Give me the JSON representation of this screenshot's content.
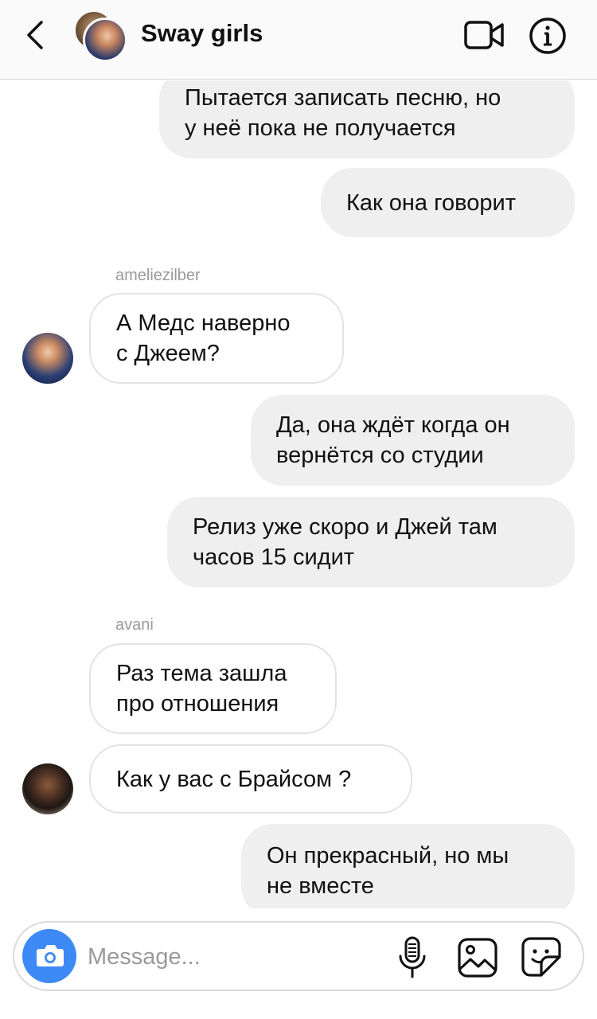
{
  "header": {
    "title": "Sway girls",
    "icons": {
      "back": "chevron-left-icon",
      "video": "video-camera-icon",
      "info": "info-icon"
    }
  },
  "messages": [
    {
      "direction": "outgoing",
      "text": "Пытается записать песню, но\nу неё пока не получается"
    },
    {
      "direction": "outgoing",
      "text": "Как она говорит"
    },
    {
      "direction": "incoming",
      "sender": "ameliezilber",
      "text": "А Медс наверно\nс Джеем?"
    },
    {
      "direction": "outgoing",
      "text": "Да, она ждёт когда он\nвернётся со студии"
    },
    {
      "direction": "outgoing",
      "text": "Релиз уже скоро и Джей там\nчасов 15 сидит"
    },
    {
      "direction": "incoming",
      "sender": "avani",
      "text": "Раз тема зашла\nпро отношения"
    },
    {
      "direction": "incoming",
      "text": "Как у вас с Брайсом ?"
    },
    {
      "direction": "outgoing",
      "text": "Он прекрасный, но мы\nне вместе"
    }
  ],
  "composer": {
    "placeholder": "Message...",
    "icons": {
      "camera": "camera-icon",
      "mic": "microphone-icon",
      "gallery": "image-icon",
      "sticker": "sticker-icon"
    }
  },
  "colors": {
    "outgoing_bubble": "#efefef",
    "incoming_border": "#e3e3e3",
    "camera_button": "#3d8af7",
    "sender_label": "#9a9a9a"
  }
}
